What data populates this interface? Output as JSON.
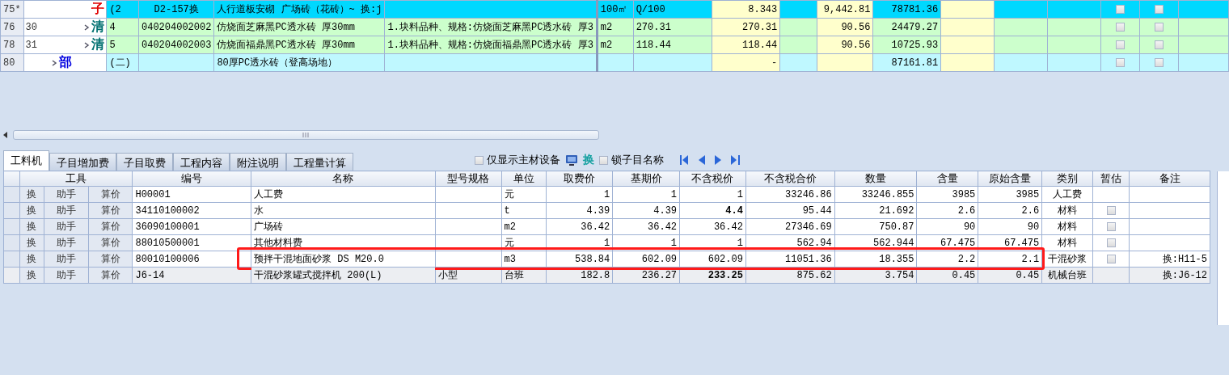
{
  "top_grid": {
    "rows": [
      {
        "row_no": "75*",
        "sub_no": "",
        "kind": "sub",
        "type_mark": "子",
        "expander": false,
        "seq": "(2",
        "code": "D2-157换",
        "name": "人行道板安砌 广场砖（花砖）~ 换:j",
        "feature": "",
        "unit": "100㎡",
        "quantity_expr": "Q/100",
        "quantity": "8.343",
        "unit_price": "9,442.81",
        "total": "78781.36",
        "check_1": false,
        "check_2": false
      },
      {
        "row_no": "76",
        "sub_no": "30",
        "kind": "item",
        "type_mark": "清",
        "expander": true,
        "seq": "4",
        "code": "040204002002",
        "name": "仿烧面芝麻黑PC透水砖 厚30mm",
        "feature": "1.块料品种、规格:仿烧面芝麻黑PC透水砖 厚3",
        "unit": "m2",
        "quantity_expr": "270.31",
        "quantity": "270.31",
        "unit_price": "90.56",
        "total": "24479.27",
        "check_1": false,
        "check_2": false
      },
      {
        "row_no": "78",
        "sub_no": "31",
        "kind": "item",
        "type_mark": "清",
        "expander": true,
        "seq": "5",
        "code": "040204002003",
        "name": "仿烧面福鼎黑PC透水砖 厚30mm",
        "feature": "1.块料品种、规格:仿烧面福鼎黑PC透水砖 厚3",
        "unit": "m2",
        "quantity_expr": "118.44",
        "quantity": "118.44",
        "unit_price": "90.56",
        "total": "10725.93",
        "check_1": false,
        "check_2": false
      },
      {
        "row_no": "80",
        "sub_no": "",
        "kind": "section",
        "type_mark": "部",
        "expander": true,
        "seq": "(二)",
        "code": "",
        "name": "80厚PC透水砖（登高场地）",
        "feature": "",
        "unit": "",
        "quantity_expr": "",
        "quantity": "-",
        "unit_price": "",
        "total": "87161.81",
        "check_1": false,
        "check_2": false
      }
    ]
  },
  "tabs": [
    {
      "label": "工料机",
      "selected": true
    },
    {
      "label": "子目增加费",
      "selected": false
    },
    {
      "label": "子目取费",
      "selected": false
    },
    {
      "label": "工程内容",
      "selected": false
    },
    {
      "label": "附注说明",
      "selected": false
    },
    {
      "label": "工程量计算",
      "selected": false
    }
  ],
  "toolbar": {
    "main_only": {
      "label": "仅显示主材设备",
      "checked": false
    },
    "replace_label": "换",
    "lock_name": {
      "label": "锁子目名称",
      "checked": false
    }
  },
  "detail_grid": {
    "columns": [
      "工具",
      "编号",
      "名称",
      "型号规格",
      "单位",
      "取费价",
      "基期价",
      "不含税价",
      "不含税合价",
      "数量",
      "含量",
      "原始含量",
      "类别",
      "暂估",
      "备注"
    ],
    "rows": [
      {
        "tools": [
          "换",
          "助手",
          "算价"
        ],
        "code": "H00001",
        "name": "人工费",
        "spec": "",
        "unit": "元",
        "fee_price": "1",
        "base_price": "1",
        "net_price": "1",
        "net_price_bold": false,
        "net_total_text": "33246.86",
        "quantity": "33246.855",
        "content": "3985",
        "orig_content": "3985",
        "category": "人工费",
        "remark": "",
        "selected": false,
        "highlighted": false
      },
      {
        "tools": [
          "换",
          "助手",
          "算价"
        ],
        "code": "34110100002",
        "name": "水",
        "spec": "",
        "unit": "t",
        "fee_price": "4.39",
        "base_price": "4.39",
        "net_price": "4.4",
        "net_price_bold": true,
        "net_total_text": "95.44",
        "quantity": "21.692",
        "content": "2.6",
        "orig_content": "2.6",
        "category": "材料",
        "estimate_checked": false,
        "remark": "",
        "selected": false,
        "highlighted": false
      },
      {
        "tools": [
          "换",
          "助手",
          "算价"
        ],
        "code": "36090100001",
        "name": "广场砖",
        "spec": "",
        "unit": "m2",
        "fee_price": "36.42",
        "base_price": "36.42",
        "net_price": "36.42",
        "net_price_bold": false,
        "net_total_text": "27346.69",
        "quantity": "750.87",
        "content": "90",
        "orig_content": "90",
        "category": "材料",
        "estimate_checked": false,
        "remark": "",
        "selected": false,
        "highlighted": false
      },
      {
        "tools": [
          "换",
          "助手",
          "算价"
        ],
        "code": "88010500001",
        "name": "其他材料费",
        "spec": "",
        "unit": "元",
        "fee_price": "1",
        "base_price": "1",
        "net_price": "1",
        "net_price_bold": false,
        "net_total_text": "562.94",
        "quantity": "562.944",
        "content": "67.475",
        "orig_content": "67.475",
        "category": "材料",
        "estimate_checked": false,
        "remark": "",
        "selected": false,
        "highlighted": false
      },
      {
        "tools": [
          "换",
          "助手",
          "算价"
        ],
        "code": "80010100006",
        "name": "预拌干混地面砂浆 DS M20.0",
        "spec": "",
        "unit": "m3",
        "fee_price": "538.84",
        "base_price": "602.09",
        "net_price": "602.09",
        "net_price_bold": false,
        "net_total_text": "11051.36",
        "quantity": "18.355",
        "content": "2.2",
        "orig_content": "2.1",
        "category": "干混砂浆",
        "estimate_checked": false,
        "remark": "换:H11-5",
        "selected": false,
        "highlighted": true
      },
      {
        "tools": [
          "换",
          "助手",
          "算价"
        ],
        "code": "J6-14",
        "name": "干混砂浆罐式搅拌机 200(L)",
        "spec": "小型",
        "unit": "台班",
        "fee_price": "182.8",
        "base_price": "236.27",
        "net_price": "233.25",
        "net_price_bold": true,
        "net_total_text": "875.62",
        "quantity": "3.754",
        "content": "0.45",
        "orig_content": "0.45",
        "category": "机械台班",
        "remark": "换:J6-12",
        "selected": true,
        "highlighted": false
      }
    ]
  }
}
